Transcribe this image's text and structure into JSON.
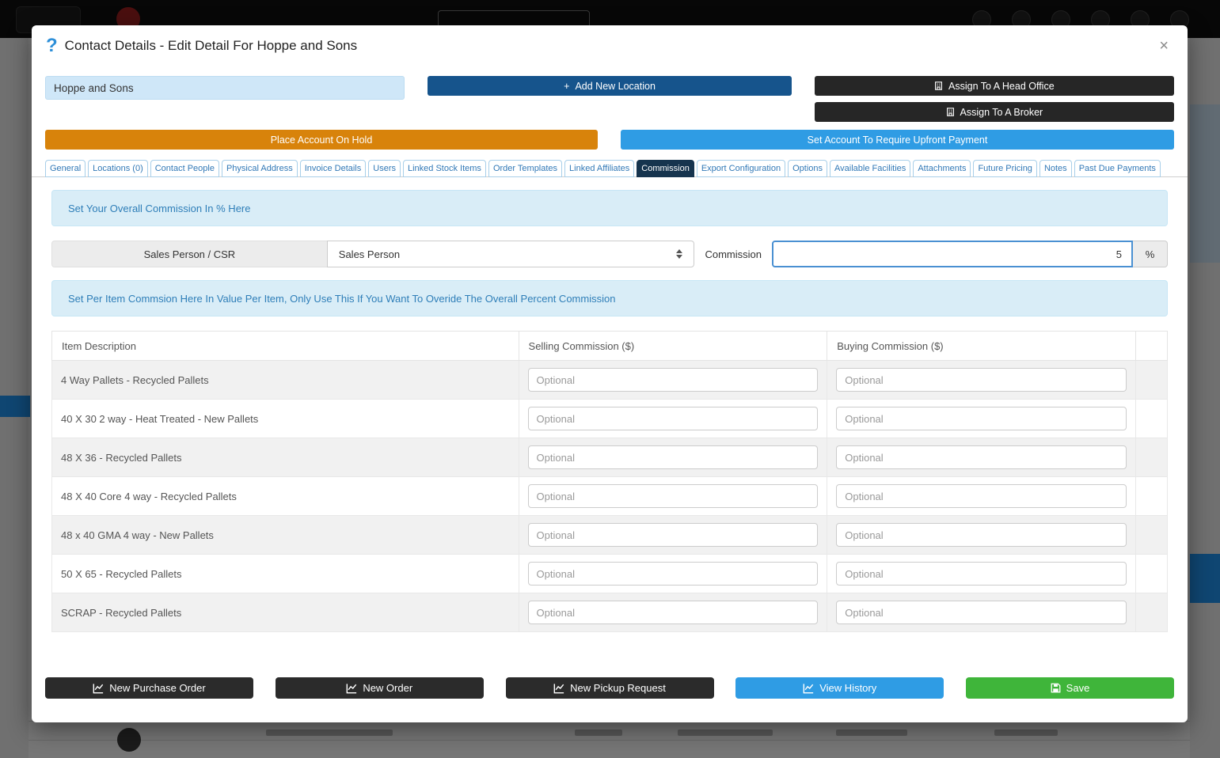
{
  "colors": {
    "accent_blue": "#2f9ce4",
    "dark_blue": "#16548c",
    "orange": "#d8830b",
    "green": "#3fb53a",
    "dark_button": "#2b2b2b",
    "active_tab": "#16344e",
    "info_bg": "#d9edf7",
    "info_text": "#2e7eb8",
    "company_input_bg": "#cfe7f8"
  },
  "icons": {
    "help": "?",
    "close": "×",
    "add": "+",
    "building": "building-glyph",
    "chart": "chart-line-glyph",
    "save": "floppy-glyph",
    "select_arrows": "up-down-triangles"
  },
  "modal": {
    "title": "Contact Details - Edit Detail For Hoppe and Sons",
    "company_input": {
      "value": "Hoppe and Sons"
    },
    "actions": {
      "add_new_location": "Add New Location",
      "assign_head_office": "Assign To A Head Office",
      "assign_broker": "Assign To A Broker",
      "place_on_hold": "Place Account On Hold",
      "require_upfront": "Set Account To Require Upfront Payment"
    },
    "tabs": [
      {
        "label": "General",
        "active": false
      },
      {
        "label": "Locations (0)",
        "active": false
      },
      {
        "label": "Contact People",
        "active": false
      },
      {
        "label": "Physical Address",
        "active": false
      },
      {
        "label": "Invoice Details",
        "active": false
      },
      {
        "label": "Users",
        "active": false
      },
      {
        "label": "Linked Stock Items",
        "active": false
      },
      {
        "label": "Order Templates",
        "active": false
      },
      {
        "label": "Linked Affiliates",
        "active": false
      },
      {
        "label": "Commission",
        "active": true
      },
      {
        "label": "Export Configuration",
        "active": false
      },
      {
        "label": "Options",
        "active": false
      },
      {
        "label": "Available Facilities",
        "active": false
      },
      {
        "label": "Attachments",
        "active": false
      },
      {
        "label": "Future Pricing",
        "active": false
      },
      {
        "label": "Notes",
        "active": false
      },
      {
        "label": "Past Due Payments",
        "active": false
      }
    ],
    "overall_commission": {
      "info": "Set Your Overall Commission In % Here",
      "role_label": "Sales Person / CSR",
      "role_select_value": "Sales Person",
      "commission_label": "Commission",
      "commission_value": "5",
      "unit": "%"
    },
    "per_item_commission": {
      "info": "Set Per Item Commsion Here In Value Per Item, Only Use This If You Want To Overide The Overall Percent Commission",
      "headers": [
        "Item Description",
        "Selling Commission ($)",
        "Buying Commission ($)"
      ],
      "input_placeholder": "Optional",
      "items": [
        "4 Way Pallets - Recycled Pallets",
        "40 X 30 2 way - Heat Treated - New Pallets",
        "48 X 36 - Recycled Pallets",
        "48 X 40 Core 4 way - Recycled Pallets",
        "48 x 40 GMA 4 way - New Pallets",
        "50 X 65 - Recycled Pallets",
        "SCRAP - Recycled Pallets"
      ]
    },
    "footer": {
      "new_purchase_order": "New Purchase Order",
      "new_order": "New Order",
      "new_pickup_request": "New Pickup Request",
      "view_history": "View History",
      "save": "Save"
    }
  }
}
